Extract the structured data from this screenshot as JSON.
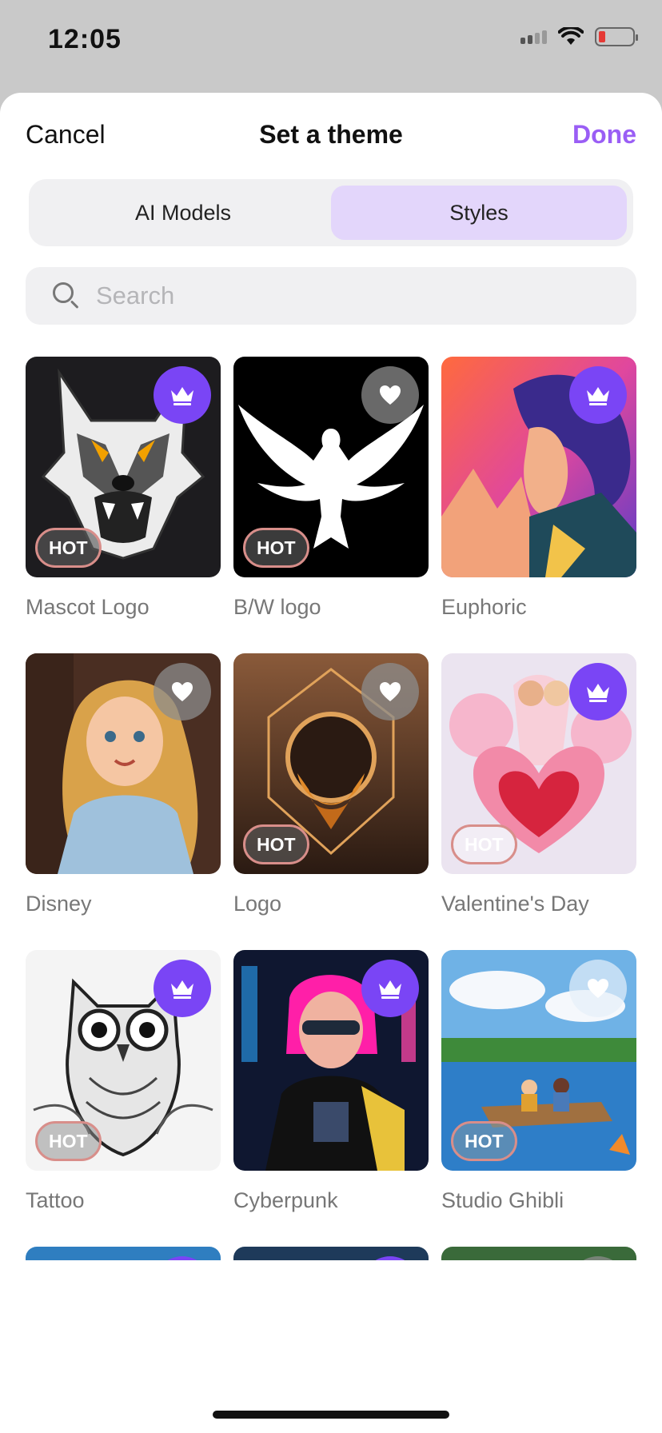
{
  "status": {
    "time": "12:05"
  },
  "nav": {
    "cancel_label": "Cancel",
    "title": "Set a theme",
    "done_label": "Done"
  },
  "tabs": [
    {
      "label": "AI Models",
      "active": false
    },
    {
      "label": "Styles",
      "active": true
    }
  ],
  "search": {
    "placeholder": "Search",
    "value": ""
  },
  "colors": {
    "accent": "#9a5ef5",
    "premium": "#7a45f5",
    "tab_active": "#e3d6fb"
  },
  "badges": {
    "hot_label": "HOT"
  },
  "themes": [
    {
      "name": "Mascot Logo",
      "badge": "crown-icon",
      "hot": true
    },
    {
      "name": "B/W logo",
      "badge": "heart-icon",
      "hot": true
    },
    {
      "name": "Euphoric",
      "badge": "crown-icon",
      "hot": false
    },
    {
      "name": "Disney",
      "badge": "heart-icon",
      "hot": false
    },
    {
      "name": "Logo",
      "badge": "heart-icon",
      "hot": true
    },
    {
      "name": "Valentine's Day",
      "badge": "crown-icon",
      "hot": true
    },
    {
      "name": "Tattoo",
      "badge": "crown-icon",
      "hot": true
    },
    {
      "name": "Cyberpunk",
      "badge": "crown-icon",
      "hot": false
    },
    {
      "name": "Studio Ghibli",
      "badge": "heart-icon",
      "hot": true
    },
    {
      "name": "",
      "badge": "crown-icon",
      "hot": false
    },
    {
      "name": "",
      "badge": "crown-icon",
      "hot": false
    },
    {
      "name": "",
      "badge": "heart-outline-icon",
      "hot": false
    }
  ]
}
